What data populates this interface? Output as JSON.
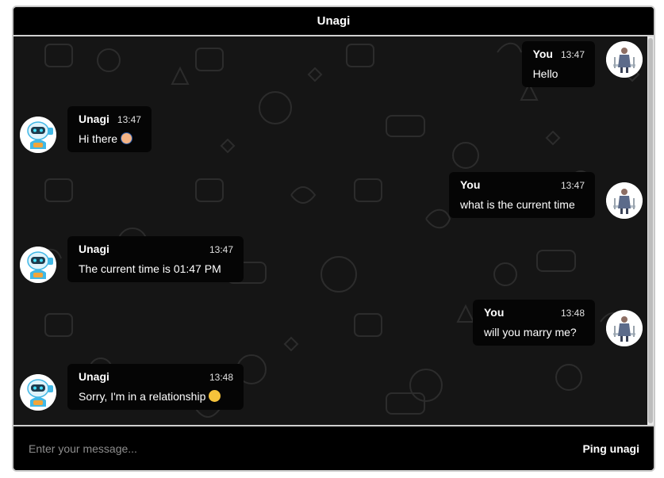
{
  "header": {
    "title": "Unagi"
  },
  "messages": [
    {
      "side": "right",
      "sender": "You",
      "time": "13:47",
      "text": "Hello",
      "emoji": ""
    },
    {
      "side": "left",
      "sender": "Unagi",
      "time": "13:47",
      "text": "Hi there",
      "emoji": "raising-hand-emoji"
    },
    {
      "side": "right",
      "sender": "You",
      "time": "13:47",
      "text": "what is the current time",
      "emoji": ""
    },
    {
      "side": "left",
      "sender": "Unagi",
      "time": "13:47",
      "text": "The current time is 01:47 PM",
      "emoji": ""
    },
    {
      "side": "right",
      "sender": "You",
      "time": "13:48",
      "text": "will you marry me?",
      "emoji": ""
    },
    {
      "side": "left",
      "sender": "Unagi",
      "time": "13:48",
      "text": "Sorry, I'm in a relationship",
      "emoji": "smiling-face-emoji"
    }
  ],
  "input": {
    "placeholder": "Enter your message...",
    "value": ""
  },
  "send_button": {
    "label": "Ping unagi"
  },
  "colors": {
    "background": "#000000",
    "pattern": "#2a2a2a",
    "border": "#cfcfcf",
    "bot_avatar_accent": "#41b8e6"
  }
}
